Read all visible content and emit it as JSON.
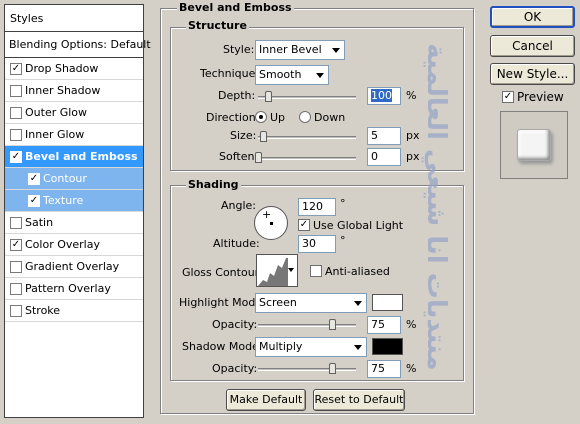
{
  "styles_panel": {
    "header": "Styles",
    "blending_options": "Blending Options: Default",
    "items": [
      {
        "label": "Drop Shadow",
        "checked": true
      },
      {
        "label": "Inner Shadow",
        "checked": false
      },
      {
        "label": "Outer Glow",
        "checked": false
      },
      {
        "label": "Inner Glow",
        "checked": false
      },
      {
        "label": "Bevel and Emboss",
        "checked": true
      },
      {
        "label": "Contour",
        "checked": true
      },
      {
        "label": "Texture",
        "checked": true
      },
      {
        "label": "Satin",
        "checked": false
      },
      {
        "label": "Color Overlay",
        "checked": true
      },
      {
        "label": "Gradient Overlay",
        "checked": false
      },
      {
        "label": "Pattern Overlay",
        "checked": false
      },
      {
        "label": "Stroke",
        "checked": false
      }
    ]
  },
  "bevel": {
    "title": "Bevel and Emboss",
    "structure": {
      "title": "Structure",
      "style_label": "Style:",
      "style_value": "Inner Bevel",
      "technique_label": "Technique:",
      "technique_value": "Smooth",
      "depth_label": "Depth:",
      "depth_value": "100",
      "depth_unit": "%",
      "direction_label": "Direction:",
      "up_label": "Up",
      "down_label": "Down",
      "direction": "Up",
      "size_label": "Size:",
      "size_value": "5",
      "size_unit": "px",
      "soften_label": "Soften:",
      "soften_value": "0",
      "soften_unit": "px"
    },
    "shading": {
      "title": "Shading",
      "angle_label": "Angle:",
      "angle_value": "120",
      "angle_unit": "°",
      "global_light_label": "Use Global Light",
      "global_light": true,
      "altitude_label": "Altitude:",
      "altitude_value": "30",
      "altitude_unit": "°",
      "gloss_label": "Gloss Contour:",
      "anti_aliased_label": "Anti-aliased",
      "anti_aliased": false,
      "highlight_mode_label": "Highlight Mode:",
      "highlight_mode_value": "Screen",
      "highlight_color": "#ffffff",
      "highlight_opacity_label": "Opacity:",
      "highlight_opacity_value": "75",
      "highlight_opacity_unit": "%",
      "shadow_mode_label": "Shadow Mode:",
      "shadow_mode_value": "Multiply",
      "shadow_color": "#000000",
      "shadow_opacity_label": "Opacity:",
      "shadow_opacity_value": "75",
      "shadow_opacity_unit": "%"
    },
    "make_default": "Make Default",
    "reset_default": "Reset to Default"
  },
  "watermark": "منتديات انا شيعي العالمية",
  "buttons": {
    "ok": "OK",
    "cancel": "Cancel",
    "new_style": "New Style...",
    "preview_label": "Preview",
    "preview_checked": true
  },
  "icons": {
    "check": "✓",
    "angle_center": "+"
  },
  "colors": {
    "selection": "#3399ff",
    "sub_selection": "#7fb5ee",
    "watermark": "#9aa6c8"
  }
}
